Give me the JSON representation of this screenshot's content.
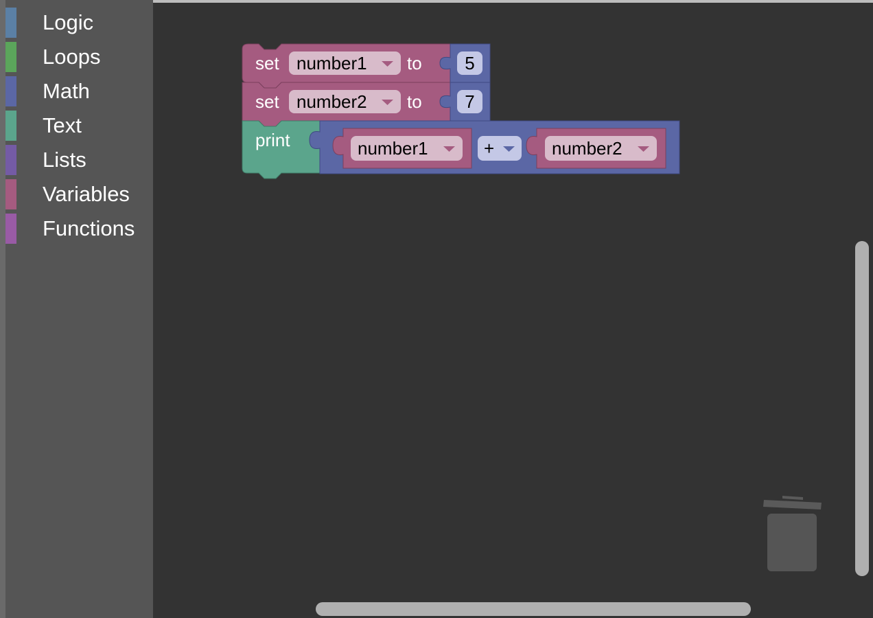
{
  "toolbox": {
    "categories": [
      {
        "label": "Logic",
        "color": "#5b80a5"
      },
      {
        "label": "Loops",
        "color": "#5ba55b"
      },
      {
        "label": "Math",
        "color": "#5b67a5"
      },
      {
        "label": "Text",
        "color": "#5ba58c"
      },
      {
        "label": "Lists",
        "color": "#745ba5"
      },
      {
        "label": "Variables",
        "color": "#a55b80"
      },
      {
        "label": "Functions",
        "color": "#995ba5"
      }
    ]
  },
  "blocks": {
    "set1": {
      "keyword": "set",
      "variable": "number1",
      "to_label": "to",
      "value": "5"
    },
    "set2": {
      "keyword": "set",
      "variable": "number2",
      "to_label": "to",
      "value": "7"
    },
    "print": {
      "keyword": "print",
      "left_variable": "number1",
      "operator": "+",
      "right_variable": "number2"
    }
  },
  "colors": {
    "variables": "#a55b80",
    "math": "#5b67a5",
    "text": "#5ba58c",
    "field_bg": "#d8bbca",
    "number_bg": "#c4c8e6"
  },
  "icons": {
    "trash": "trash-can-icon",
    "dropdown": "chevron-down-icon"
  }
}
